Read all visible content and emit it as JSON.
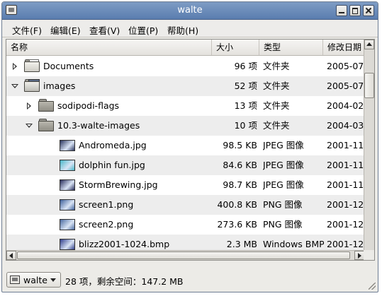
{
  "window": {
    "title": "walte"
  },
  "menu": [
    {
      "label": "文件(F)"
    },
    {
      "label": "编辑(E)"
    },
    {
      "label": "查看(V)"
    },
    {
      "label": "位置(P)"
    },
    {
      "label": "帮助(H)"
    }
  ],
  "columns": {
    "name": "名称",
    "size": "大小",
    "type": "类型",
    "modified": "修改日期"
  },
  "rows": [
    {
      "name": "Documents",
      "size": "96 项",
      "type": "文件夹",
      "date": "2005-07",
      "level": 0,
      "expander": "collapsed",
      "icon": "documents-folder-icon"
    },
    {
      "name": "images",
      "size": "52 项",
      "type": "文件夹",
      "date": "2005-07",
      "level": 0,
      "expander": "expanded",
      "icon": "images-folder-icon"
    },
    {
      "name": "sodipodi-flags",
      "size": "13 项",
      "type": "文件夹",
      "date": "2004-02",
      "level": 1,
      "expander": "collapsed",
      "icon": "folder-icon"
    },
    {
      "name": "10.3-walte-images",
      "size": "10 项",
      "type": "文件夹",
      "date": "2004-03",
      "level": 1,
      "expander": "expanded",
      "icon": "folder-icon"
    },
    {
      "name": "Andromeda.jpg",
      "size": "98.5 KB",
      "type": "JPEG 图像",
      "date": "2001-11-",
      "level": 2,
      "icon": "image-thumbnail-icon",
      "thumb": "#2a3560"
    },
    {
      "name": "dolphin fun.jpg",
      "size": "84.6 KB",
      "type": "JPEG 图像",
      "date": "2001-11-",
      "level": 2,
      "icon": "image-thumbnail-icon",
      "thumb": "#46b6c8"
    },
    {
      "name": "StormBrewing.jpg",
      "size": "98.7 KB",
      "type": "JPEG 图像",
      "date": "2001-11-",
      "level": 2,
      "icon": "image-thumbnail-icon",
      "thumb": "#262b5a"
    },
    {
      "name": "screen1.png",
      "size": "400.8 KB",
      "type": "PNG 图像",
      "date": "2001-12",
      "level": 2,
      "icon": "image-thumbnail-icon",
      "thumb": "#3d5f9a"
    },
    {
      "name": "screen2.png",
      "size": "273.6 KB",
      "type": "PNG 图像",
      "date": "2001-12",
      "level": 2,
      "icon": "image-thumbnail-icon",
      "thumb": "#4a6aa0"
    },
    {
      "name": "blizz2001-1024.bmp",
      "size": "2.3 MB",
      "type": "Windows BMP",
      "date": "2001-12",
      "level": 2,
      "icon": "image-thumbnail-icon",
      "thumb": "#2f3d8a"
    }
  ],
  "statusbar": {
    "location": "walte",
    "info": "28 项，剩余空间：147.2 MB"
  }
}
